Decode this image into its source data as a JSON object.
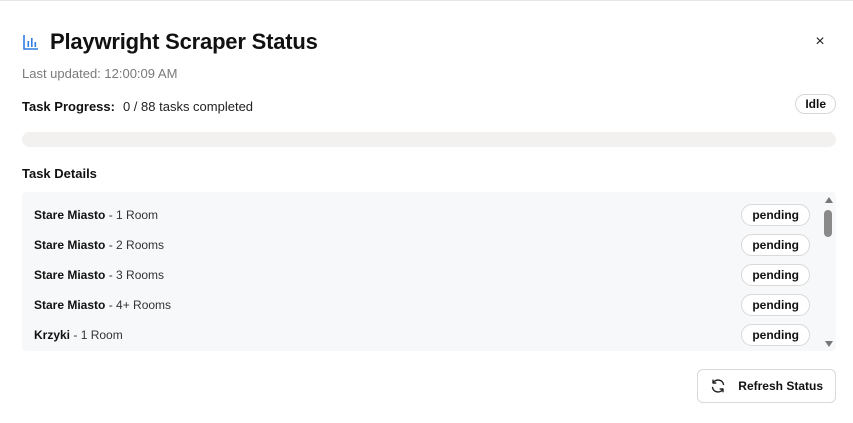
{
  "dialog": {
    "title": "Playwright Scraper Status",
    "title_icon": "bar-chart-icon",
    "close_label": "×",
    "last_updated": "Last updated: 12:00:09 AM"
  },
  "progress": {
    "label": "Task Progress:",
    "text": "0 / 88 tasks completed",
    "status": "Idle",
    "completed_fraction": 0
  },
  "tasks": {
    "section_title": "Task Details",
    "items": [
      {
        "name": "Stare Miasto",
        "separator": " - ",
        "rooms": "1 Room",
        "status": "pending"
      },
      {
        "name": "Stare Miasto",
        "separator": " - ",
        "rooms": "2 Rooms",
        "status": "pending"
      },
      {
        "name": "Stare Miasto",
        "separator": " - ",
        "rooms": "3 Rooms",
        "status": "pending"
      },
      {
        "name": "Stare Miasto",
        "separator": " - ",
        "rooms": "4+ Rooms",
        "status": "pending"
      },
      {
        "name": "Krzyki",
        "separator": " - ",
        "rooms": "1 Room",
        "status": "pending"
      }
    ]
  },
  "actions": {
    "refresh_label": "Refresh Status",
    "refresh_icon": "refresh-icon"
  },
  "colors": {
    "accent_icon": "#2f7de1",
    "progress_track": "#f2f1ef",
    "panel_bg": "#f7f8f9"
  }
}
